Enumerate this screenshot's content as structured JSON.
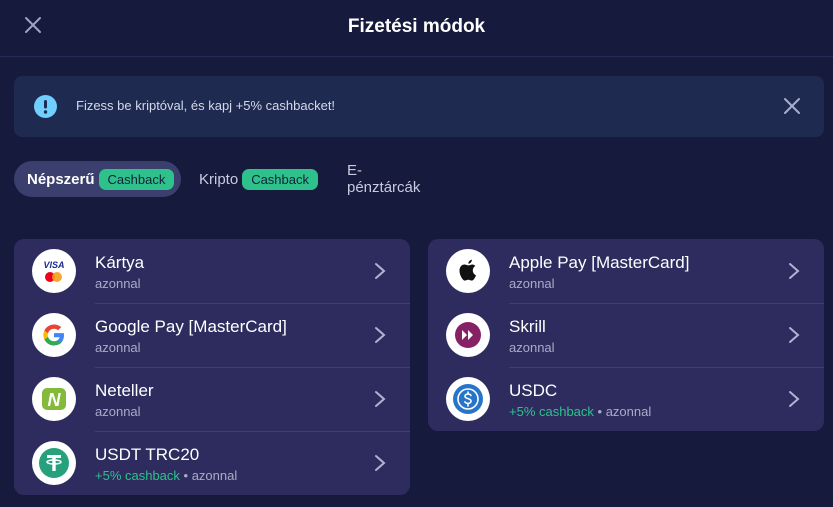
{
  "header": {
    "title": "Fizetési módok"
  },
  "banner": {
    "text": "Fizess be kriptóval, és kapj +5% cashbacket!"
  },
  "tabs": [
    {
      "label": "Népszerű",
      "badge": "Cashback"
    },
    {
      "label": "Kripto",
      "badge": "Cashback"
    },
    {
      "label": "E-pénztárcák"
    }
  ],
  "left_methods": [
    {
      "name": "Kártya",
      "sub": "azonnal",
      "logo": "visa-mastercard-icon"
    },
    {
      "name": "Google Pay [MasterCard]",
      "sub": "azonnal",
      "logo": "google-icon"
    },
    {
      "name": "Neteller",
      "sub": "azonnal",
      "logo": "neteller-icon"
    },
    {
      "name": "USDT TRC20",
      "cashback": "+5% cashback",
      "sep": " • ",
      "sub": "azonnal",
      "logo": "tether-icon"
    }
  ],
  "right_methods": [
    {
      "name": "Apple Pay [MasterCard]",
      "sub": "azonnal",
      "logo": "apple-icon"
    },
    {
      "name": "Skrill",
      "sub": "azonnal",
      "logo": "skrill-icon"
    },
    {
      "name": "USDC",
      "cashback": "+5% cashback",
      "sep": " • ",
      "sub": "azonnal",
      "logo": "usdc-icon"
    }
  ],
  "logo_text": {
    "visa": "VISA",
    "neteller": "N"
  },
  "colors": {
    "background": "#161a3d",
    "card": "#2e2c5e",
    "accent": "#2fc18c",
    "banner": "#1f2a50",
    "info": "#6fcfff"
  }
}
